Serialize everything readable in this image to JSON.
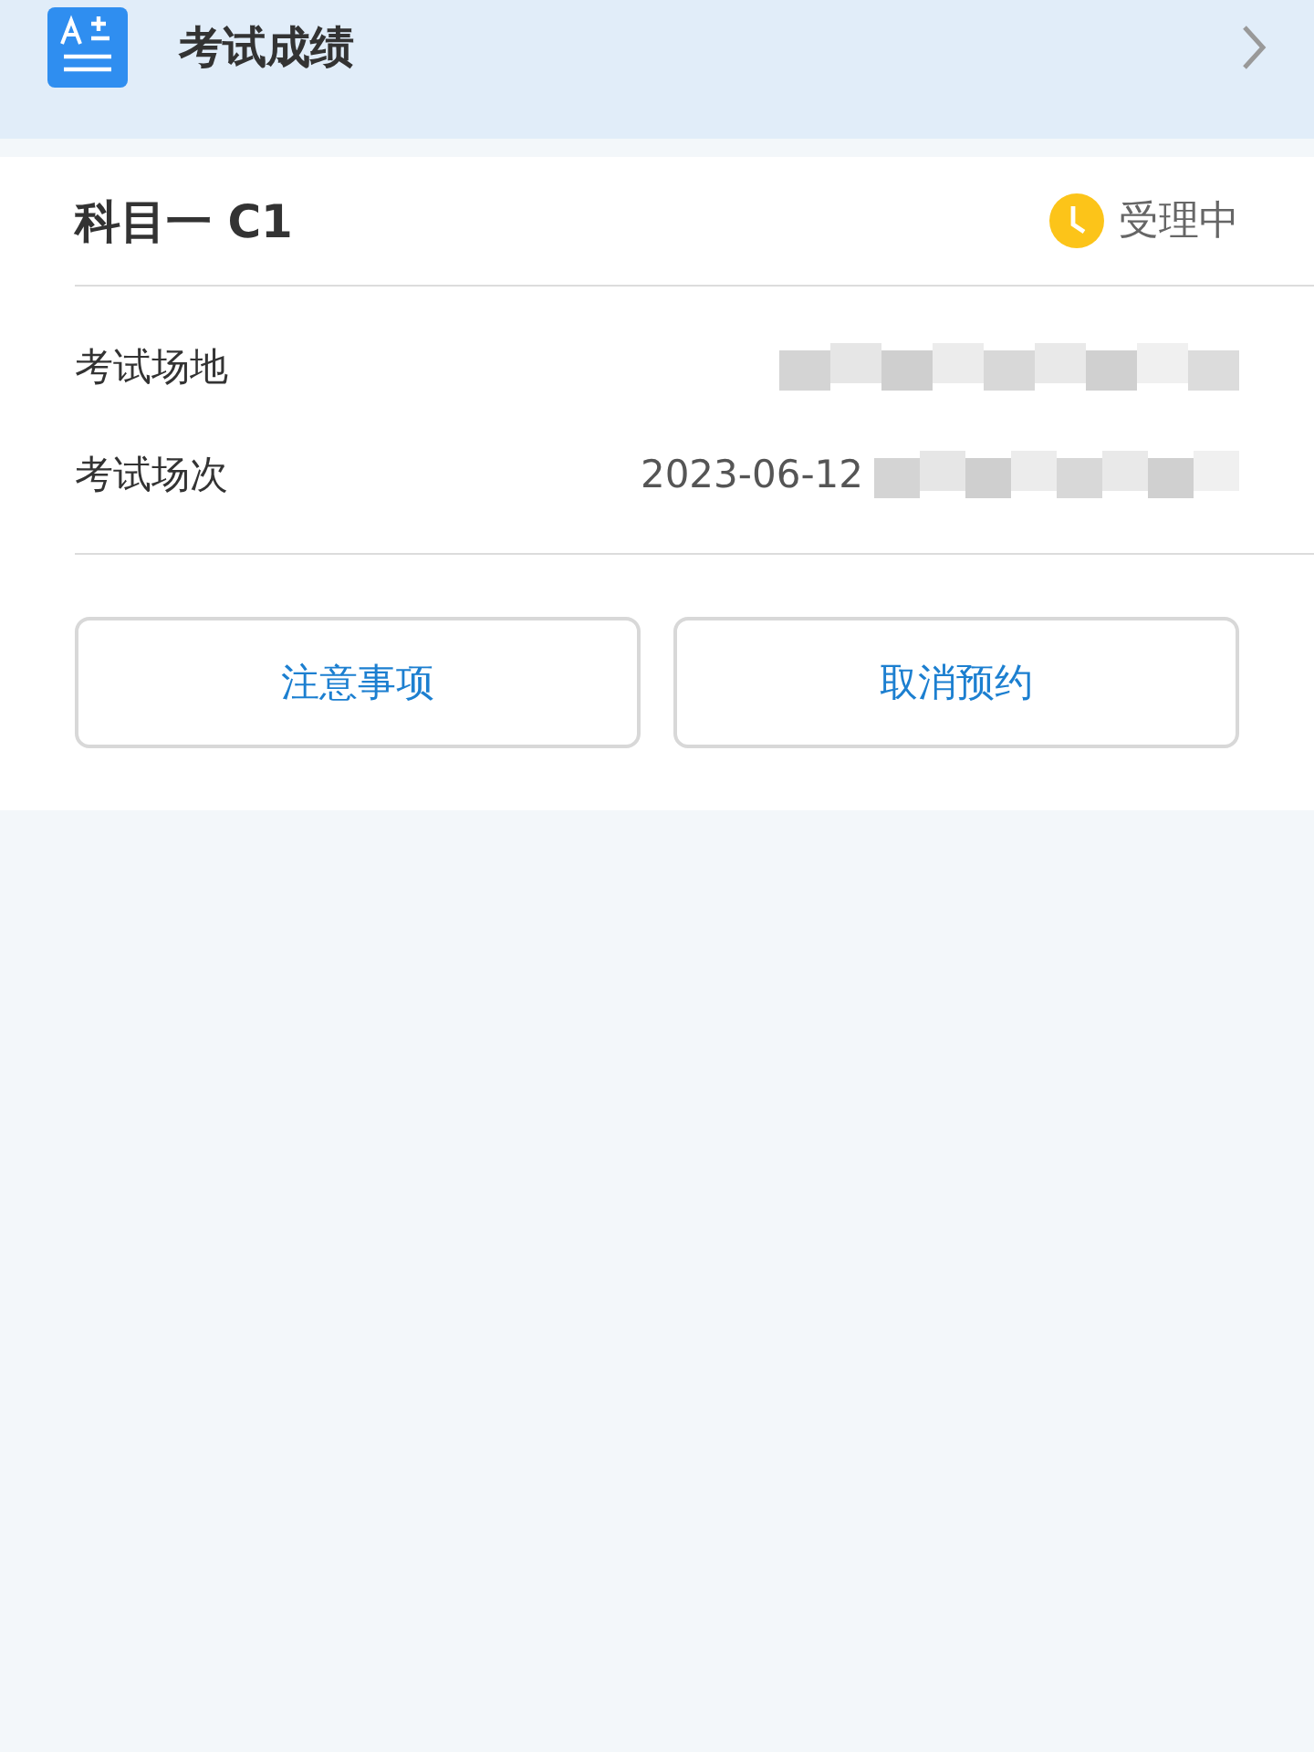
{
  "header": {
    "title": "考试成绩"
  },
  "card": {
    "subject": "科目一 C1",
    "status": "受理中",
    "rows": [
      {
        "label": "考试场地"
      },
      {
        "label": "考试场次",
        "value": "2023-06-12"
      }
    ],
    "buttons": [
      "注意事项",
      "取消预约"
    ]
  }
}
